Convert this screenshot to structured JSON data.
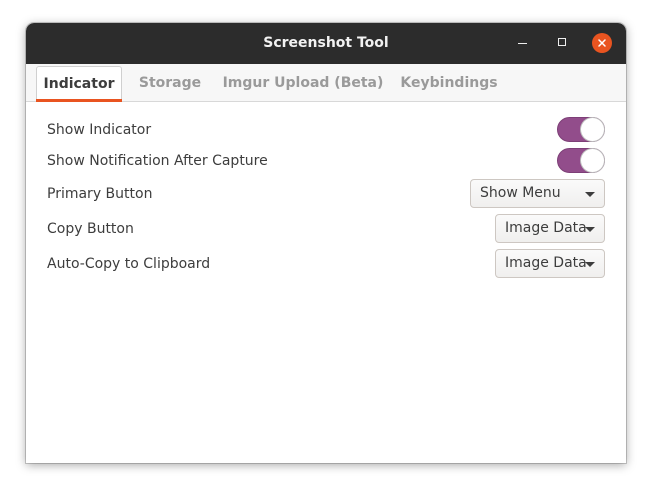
{
  "window": {
    "title": "Screenshot Tool",
    "controls": {
      "minimize_icon": "minimize-icon",
      "maximize_icon": "maximize-icon",
      "close_icon": "close-icon",
      "close_color": "#e95420"
    }
  },
  "tabs": [
    {
      "label": "Indicator",
      "active": true
    },
    {
      "label": "Storage",
      "active": false
    },
    {
      "label": "Imgur Upload (Beta)",
      "active": false
    },
    {
      "label": "Keybindings",
      "active": false
    }
  ],
  "settings": {
    "show_indicator": {
      "label": "Show Indicator",
      "enabled": true
    },
    "show_notification": {
      "label": "Show Notification After Capture",
      "enabled": true
    },
    "primary_button": {
      "label": "Primary Button",
      "value": "Show Menu"
    },
    "copy_button": {
      "label": "Copy Button",
      "value": "Image Data"
    },
    "auto_copy": {
      "label": "Auto-Copy to Clipboard",
      "value": "Image Data"
    }
  },
  "colors": {
    "accent": "#e95420",
    "switch_on": "#924d8b",
    "titlebar": "#2c2c2c"
  }
}
